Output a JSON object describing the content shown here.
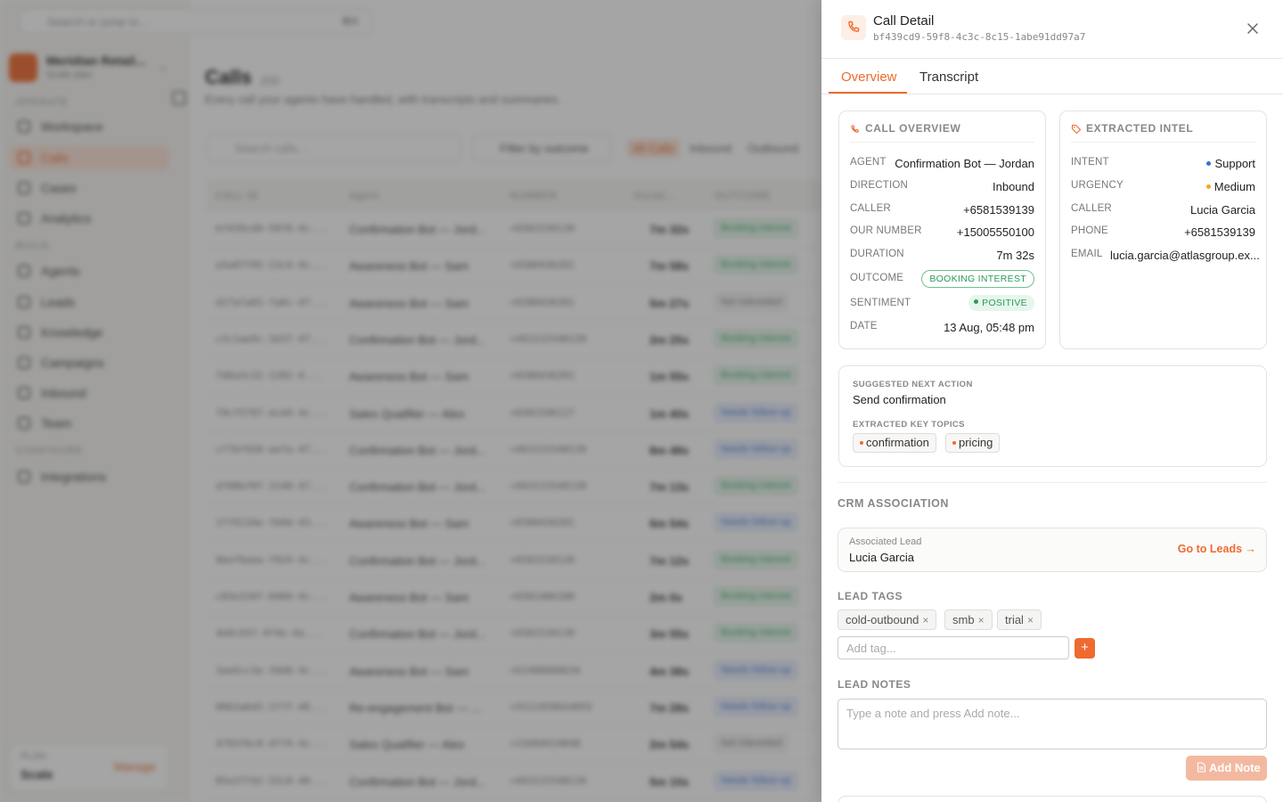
{
  "app": {
    "search_placeholder": "Search or jump to...",
    "search_shortcut": "⌘K",
    "org_name": "Meridian Retail...",
    "org_plan": "Scale plan",
    "sections": {
      "operate": "OPERATE",
      "build": "BUILD",
      "configure": "CONFIGURE"
    },
    "nav": {
      "workspace": "Workspace",
      "calls": "Calls",
      "cases": "Cases",
      "analytics": "Analytics",
      "agents": "Agents",
      "leads": "Leads",
      "knowledge": "Knowledge",
      "campaigns": "Campaigns",
      "inbound": "Inbound",
      "team": "Team",
      "integrations": "Integrations"
    },
    "plan_label": "PLAN",
    "plan_value": "Scale",
    "manage": "Manage"
  },
  "main": {
    "title": "Calls",
    "count": "200",
    "subtitle": "Every call your agents have handled, with transcripts and summaries.",
    "search_placeholder": "Search calls...",
    "filter_label": "Filter by outcome",
    "segments": {
      "all": "All Calls",
      "inbound": "Inbound",
      "outbound": "Outbound"
    },
    "columns": {
      "id": "CALL ID",
      "agent": "Agent",
      "number": "NUMBER",
      "duration": "Durati...",
      "outcome": "OUTCOME"
    },
    "rows": [
      {
        "id": "bf439cd9-59f8-4c...",
        "agent": "Confirmation Bot — Jord...",
        "number": "+6581539139",
        "duration": "7m 32s",
        "outcome": "Booking interest"
      },
      {
        "id": "e5a07f95-13c4-4c...",
        "agent": "Awareness Bot — Sam",
        "number": "+6580436201",
        "duration": "7m 58s",
        "outcome": "Booking interest"
      },
      {
        "id": "d27afa65-7a0c-47...",
        "agent": "Awareness Bot — Sam",
        "number": "+6580436201",
        "duration": "5m 27s",
        "outcome": "Not interested"
      },
      {
        "id": "c3c1ae9c-3d37-47...",
        "agent": "Confirmation Bot — Jord...",
        "number": "+491515548139",
        "duration": "2m 25s",
        "outcome": "Booking interest"
      },
      {
        "id": "7d6a3c32-1202-4...",
        "agent": "Awareness Bot — Sam",
        "number": "+6580436201",
        "duration": "1m 55s",
        "outcome": "Booking interest"
      },
      {
        "id": "f9cf5797-dcd4-4c...",
        "agent": "Sales Qualifier — Alex",
        "number": "+6581596127",
        "duration": "1m 40s",
        "outcome": "Needs follow-up"
      },
      {
        "id": "cf7bf928-aefa-47...",
        "agent": "Confirmation Bot — Jord...",
        "number": "+491515548139",
        "duration": "8m 48s",
        "outcome": "Needs follow-up"
      },
      {
        "id": "df88bf0f-3140-47...",
        "agent": "Confirmation Bot — Jord...",
        "number": "+491515548139",
        "duration": "7m 13s",
        "outcome": "Booking interest"
      },
      {
        "id": "1ff9134e-fb0d-43...",
        "agent": "Awareness Bot — Sam",
        "number": "+6580436201",
        "duration": "6m 54s",
        "outcome": "Needs follow-up"
      },
      {
        "id": "9bef6eba-f924-4c...",
        "agent": "Confirmation Bot — Jord...",
        "number": "+6581539139",
        "duration": "7m 12s",
        "outcome": "Booking interest"
      },
      {
        "id": "c83e334f-0404-4c...",
        "agent": "Awareness Bot — Sam",
        "number": "+6581406180",
        "duration": "2m 0s",
        "outcome": "Booking interest"
      },
      {
        "id": "4e0c93f-4f4e-4a...",
        "agent": "Confirmation Bot — Jord...",
        "number": "+6581539139",
        "duration": "3m 55s",
        "outcome": "Booking interest"
      },
      {
        "id": "3ae6cc3e-34d8-4c...",
        "agent": "Awareness Bot — Sam",
        "number": "+61488960634",
        "duration": "4m 38s",
        "outcome": "Needs follow-up"
      },
      {
        "id": "0062a6d5-2f7f-40...",
        "agent": "Re-engagement Bot — ...",
        "number": "+5511958924055",
        "duration": "7m 28s",
        "outcome": "Needs follow-up"
      },
      {
        "id": "4703f6c0-4774-4c...",
        "agent": "Sales Qualifier — Alex",
        "number": "+31684919048",
        "duration": "2m 54s",
        "outcome": "Not interested"
      },
      {
        "id": "85e27f42-53c8-40...",
        "agent": "Confirmation Bot — Jord...",
        "number": "+491515548139",
        "duration": "5m 10s",
        "outcome": "Needs follow-up"
      }
    ]
  },
  "panel": {
    "title": "Call Detail",
    "call_id": "bf439cd9-59f8-4c3c-8c15-1abe91dd97a7",
    "tabs": {
      "overview": "Overview",
      "transcript": "Transcript"
    },
    "overview": {
      "heading": "CALL OVERVIEW",
      "agent_k": "AGENT",
      "agent_v": "Confirmation Bot — Jordan",
      "direction_k": "DIRECTION",
      "direction_v": "Inbound",
      "caller_k": "CALLER",
      "caller_v": "+6581539139",
      "our_number_k": "OUR NUMBER",
      "our_number_v": "+15005550100",
      "duration_k": "DURATION",
      "duration_v": "7m 32s",
      "outcome_k": "OUTCOME",
      "outcome_v": "BOOKING INTEREST",
      "sentiment_k": "SENTIMENT",
      "sentiment_v": "POSITIVE",
      "date_k": "DATE",
      "date_v": "13 Aug, 05:48 pm"
    },
    "intel": {
      "heading": "EXTRACTED INTEL",
      "intent_k": "INTENT",
      "intent_v": "Support",
      "urgency_k": "URGENCY",
      "urgency_v": "Medium",
      "caller_k": "CALLER",
      "caller_v": "Lucia Garcia",
      "phone_k": "PHONE",
      "phone_v": "+6581539139",
      "email_k": "EMAIL",
      "email_v": "lucia.garcia@atlasgroup.ex..."
    },
    "next": {
      "action_label": "SUGGESTED NEXT ACTION",
      "action_value": "Send confirmation",
      "topics_label": "EXTRACTED KEY TOPICS",
      "topics": [
        "confirmation",
        "pricing"
      ]
    },
    "crm": {
      "heading": "CRM ASSOCIATION",
      "lead_label": "Associated Lead",
      "lead_name": "Lucia Garcia",
      "go_to_leads": "Go to Leads →"
    },
    "tags": {
      "heading": "LEAD TAGS",
      "items": [
        "cold-outbound",
        "smb",
        "trial"
      ],
      "add_placeholder": "Add tag...",
      "plus": "+"
    },
    "notes": {
      "heading": "LEAD NOTES",
      "placeholder": "Type a note and press Add note...",
      "add_button": "Add Note"
    }
  },
  "colors": {
    "accent": "#ef6a2f",
    "success": "#2a9b58",
    "info": "#3a6fd8",
    "warn": "#f5a623"
  }
}
